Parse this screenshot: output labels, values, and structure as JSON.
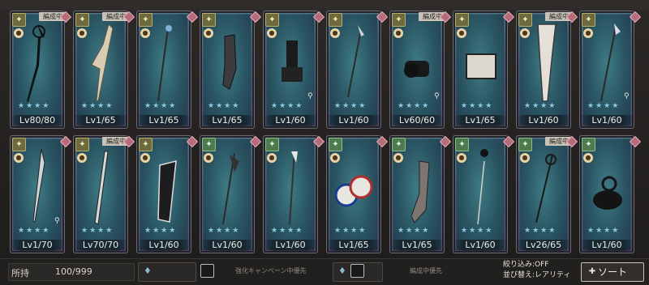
{
  "cards_row1": [
    {
      "level": "Lv80/80",
      "tag": "編成中",
      "badge": "yellow",
      "stars": "★★★★",
      "key": false
    },
    {
      "level": "Lv1/65",
      "tag": "編成中",
      "badge": "yellow",
      "stars": "★★★★",
      "key": false
    },
    {
      "level": "Lv1/65",
      "tag": "",
      "badge": "yellow",
      "stars": "★★★★",
      "key": false
    },
    {
      "level": "Lv1/65",
      "tag": "",
      "badge": "yellow",
      "stars": "★★★★",
      "key": false
    },
    {
      "level": "Lv1/60",
      "tag": "",
      "badge": "yellow",
      "stars": "★★★★",
      "key": true
    },
    {
      "level": "Lv1/60",
      "tag": "",
      "badge": "yellow",
      "stars": "★★★★",
      "key": false
    },
    {
      "level": "Lv60/60",
      "tag": "編成中",
      "badge": "yellow",
      "stars": "★★★★",
      "key": true
    },
    {
      "level": "Lv1/65",
      "tag": "",
      "badge": "yellow",
      "stars": "★★★★",
      "key": false
    },
    {
      "level": "Lv1/60",
      "tag": "編成中",
      "badge": "yellow",
      "stars": "★★★★",
      "key": false
    },
    {
      "level": "Lv1/60",
      "tag": "",
      "badge": "yellow",
      "stars": "★★★★",
      "key": true
    }
  ],
  "cards_row2": [
    {
      "level": "Lv1/70",
      "tag": "",
      "badge": "yellow",
      "stars": "★★★★",
      "key": true
    },
    {
      "level": "Lv70/70",
      "tag": "編成中",
      "badge": "yellow",
      "stars": "★★★★",
      "key": false
    },
    {
      "level": "Lv1/60",
      "tag": "",
      "badge": "yellow",
      "stars": "★★★★",
      "key": false
    },
    {
      "level": "Lv1/60",
      "tag": "",
      "badge": "green",
      "stars": "★★★★",
      "key": false
    },
    {
      "level": "Lv1/60",
      "tag": "",
      "badge": "green",
      "stars": "★★★★",
      "key": false
    },
    {
      "level": "Lv1/65",
      "tag": "",
      "badge": "green",
      "stars": "★★★★",
      "key": false
    },
    {
      "level": "Lv1/65",
      "tag": "",
      "badge": "green",
      "stars": "★★★★",
      "key": false
    },
    {
      "level": "Lv1/60",
      "tag": "",
      "badge": "green",
      "stars": "★★★★",
      "key": false
    },
    {
      "level": "Lv26/65",
      "tag": "編成中",
      "badge": "green",
      "stars": "★★★★",
      "key": false
    },
    {
      "level": "Lv1/60",
      "tag": "",
      "badge": "green",
      "stars": "★★★★",
      "key": false
    }
  ],
  "bottom": {
    "held_label": "所持",
    "held_count": "100/999",
    "opt1": "強化キャンペーン中優先",
    "opt2": "編成中優先",
    "filter": "絞り込み:OFF",
    "sort_order": "並び替え:レアリティ",
    "sort_button": "ソート"
  },
  "colors": {
    "accent_star": "#8cc9e0",
    "tag_bg": "#c9c2b6"
  }
}
